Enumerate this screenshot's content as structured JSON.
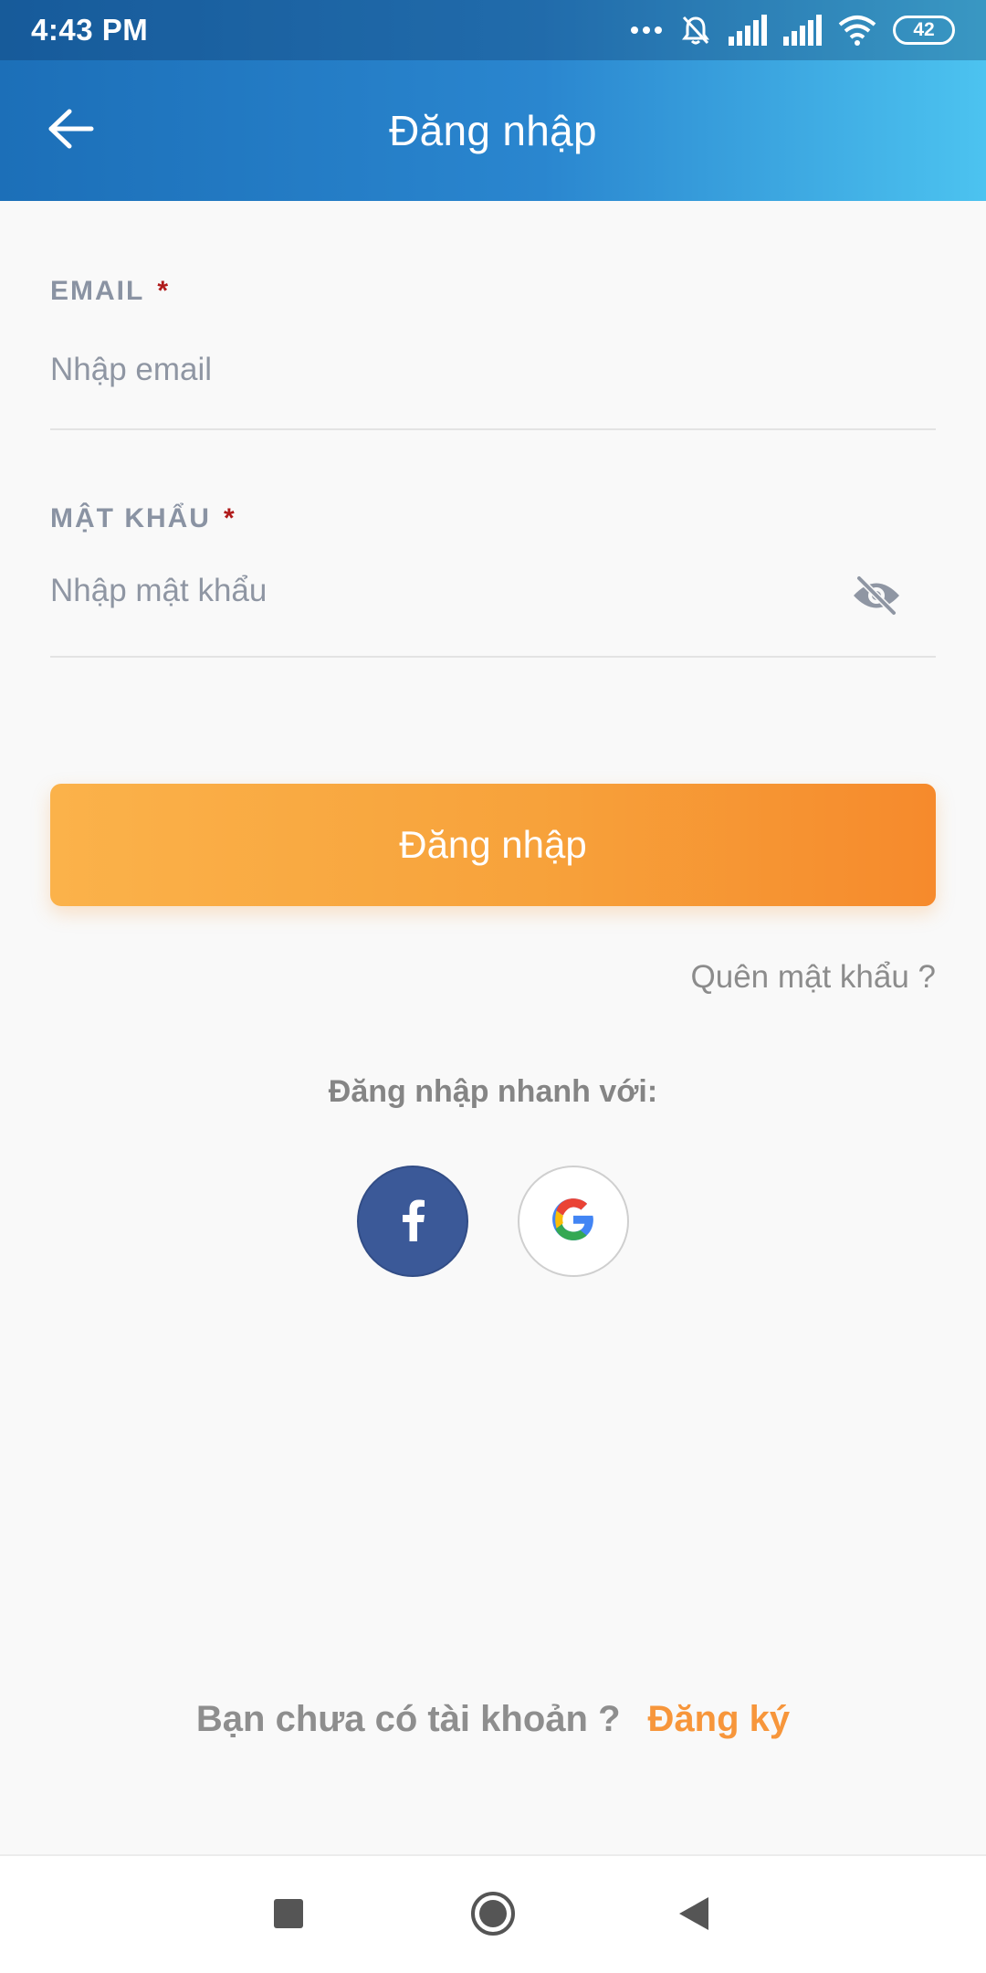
{
  "status_bar": {
    "time": "4:43 PM",
    "battery": "42",
    "icons": [
      "more-dots-icon",
      "mute-bell-icon",
      "signal-icon",
      "signal-icon",
      "wifi-icon",
      "battery-icon"
    ]
  },
  "app_bar": {
    "title": "Đăng nhập",
    "back_icon": "arrow-left-icon"
  },
  "form": {
    "email": {
      "label": "EMAIL",
      "required_mark": "*",
      "placeholder": "Nhập email",
      "value": ""
    },
    "password": {
      "label": "MẬT KHẨU",
      "required_mark": "*",
      "placeholder": "Nhập mật khẩu",
      "value": "",
      "toggle_icon": "eye-off-icon"
    },
    "submit_label": "Đăng nhập",
    "forgot_label": "Quên mật khẩu ?"
  },
  "social": {
    "label": "Đăng nhập nhanh với:",
    "providers": [
      "facebook",
      "google"
    ]
  },
  "signup": {
    "question": "Bạn chưa có tài khoản ?",
    "link": "Đăng ký"
  },
  "colors": {
    "header_start": "#1c6fb8",
    "header_end": "#4cc3f0",
    "accent_orange": "#f7963b",
    "facebook_blue": "#3b5998",
    "required_red": "#b01a1a"
  },
  "nav_bar": {
    "icons": [
      "recent-apps-icon",
      "home-icon",
      "back-triangle-icon"
    ]
  }
}
